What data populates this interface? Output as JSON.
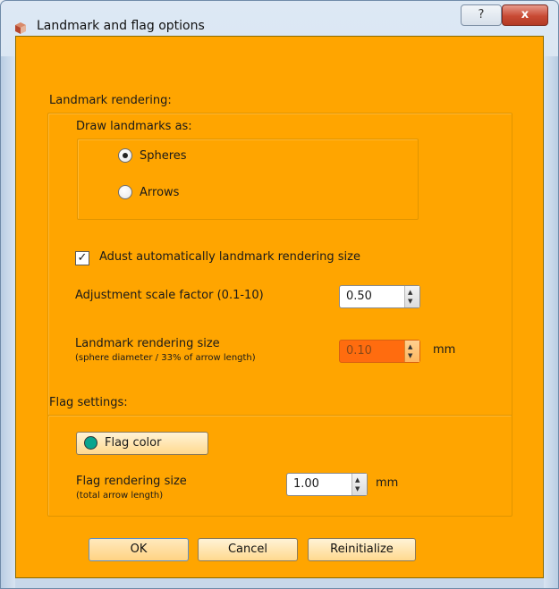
{
  "window": {
    "title": "Landmark and flag options",
    "help_label": "?",
    "close_label": "x"
  },
  "landmark": {
    "group_label": "Landmark rendering:",
    "draw_label": "Draw landmarks as:",
    "radio_spheres": "Spheres",
    "radio_arrows": "Arrows",
    "selected": "Spheres",
    "auto_adjust_label": "Adust automatically landmark rendering size",
    "auto_adjust_checked": true,
    "scale_label": "Adjustment scale factor (0.1-10)",
    "scale_value": "0.50",
    "size_label": "Landmark rendering size",
    "size_sublabel": "(sphere diameter / 33% of arrow length)",
    "size_value": "0.10",
    "size_unit": "mm"
  },
  "flag": {
    "group_label": "Flag settings:",
    "color_button": "Flag color",
    "color_swatch": "#0aa58f",
    "size_label": "Flag rendering size",
    "size_sublabel": "(total arrow length)",
    "size_value": "1.00",
    "size_unit": "mm"
  },
  "buttons": {
    "ok": "OK",
    "cancel": "Cancel",
    "reinitialize": "Reinitialize"
  }
}
